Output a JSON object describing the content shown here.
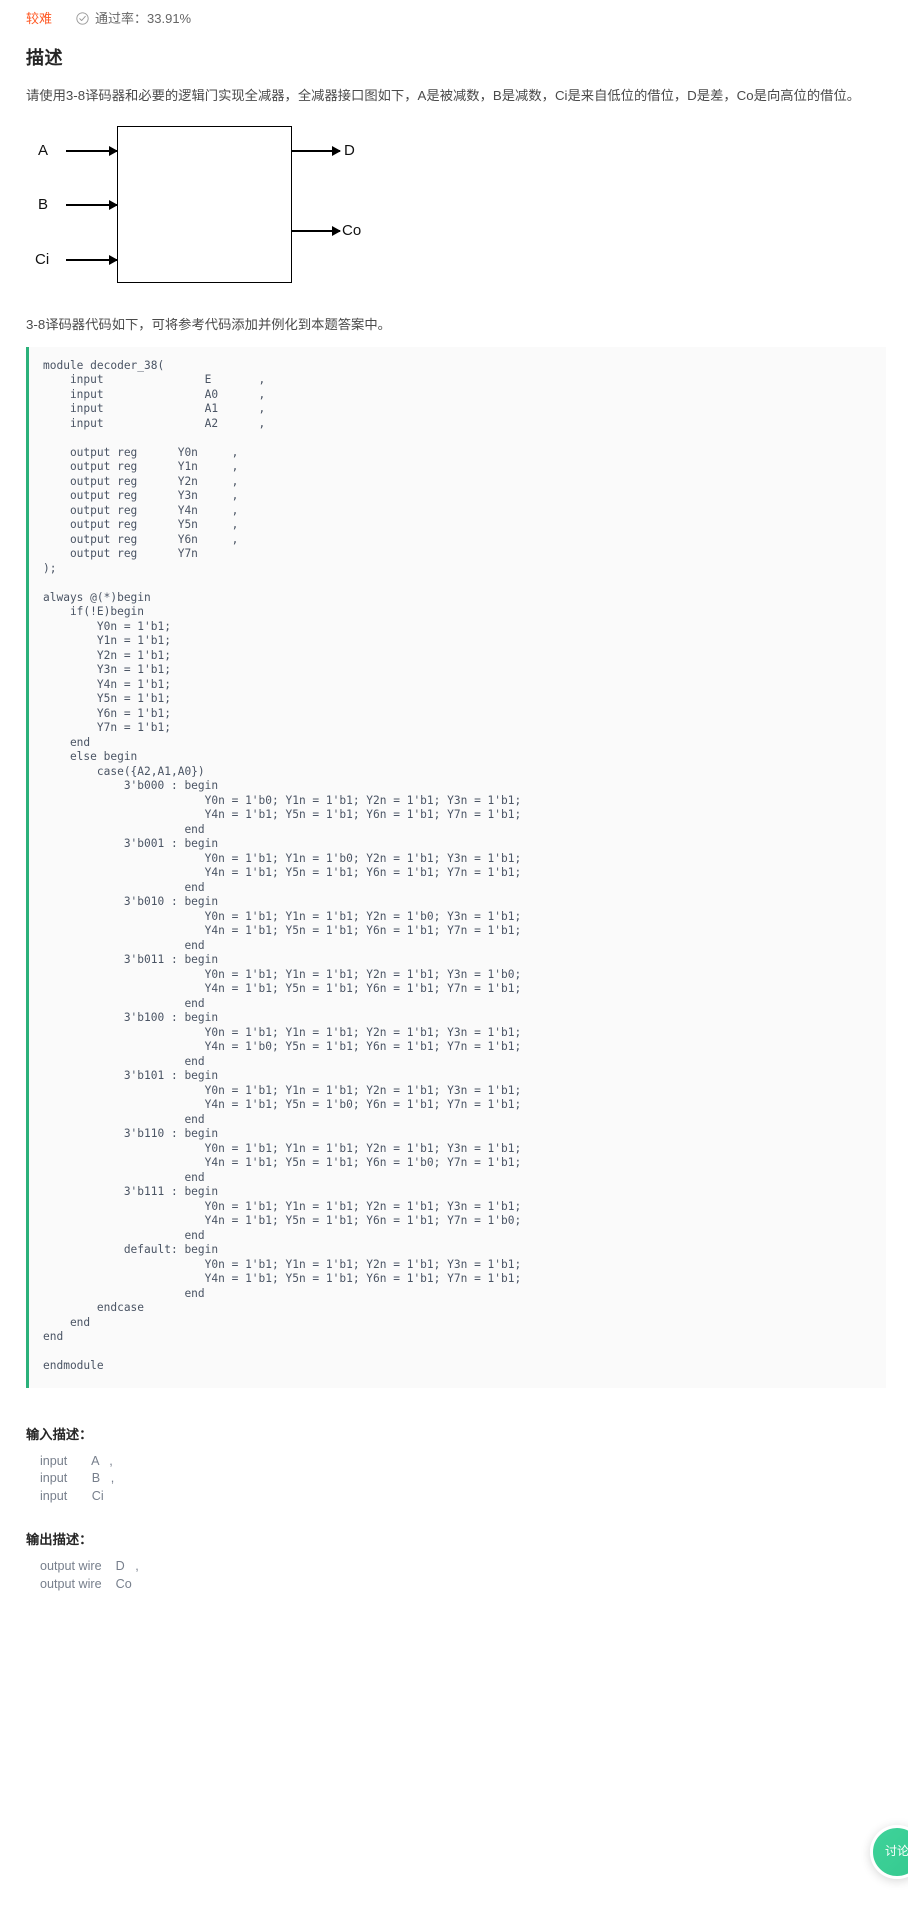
{
  "meta": {
    "difficulty": "较难",
    "pass_rate_label": "通过率：33.91%",
    "check_icon": "check-circle-icon"
  },
  "description": {
    "heading": "描述",
    "paragraph": "请使用3-8译码器和必要的逻辑门实现全减器，全减器接口图如下，A是被减数，B是减数，Ci是来自低位的借位，D是差，Co是向高位的借位。",
    "note": "3-8译码器代码如下，可将参考代码添加并例化到本题答案中。"
  },
  "diagram": {
    "inputs": [
      "A",
      "B",
      "Ci"
    ],
    "outputs": [
      "D",
      "Co"
    ],
    "label_a": "A",
    "label_b": "B",
    "label_ci": "Ci",
    "label_d": "D",
    "label_co": "Co"
  },
  "code": {
    "language": "verilog",
    "accent_color": "#2bb17a",
    "text": "module decoder_38(\n    input               E       ,\n    input               A0      ,\n    input               A1      ,\n    input               A2      ,\n\n    output reg      Y0n     ,\n    output reg      Y1n     ,\n    output reg      Y2n     ,\n    output reg      Y3n     ,\n    output reg      Y4n     ,\n    output reg      Y5n     ,\n    output reg      Y6n     ,\n    output reg      Y7n\n);\n\nalways @(*)begin\n    if(!E)begin\n        Y0n = 1'b1;\n        Y1n = 1'b1;\n        Y2n = 1'b1;\n        Y3n = 1'b1;\n        Y4n = 1'b1;\n        Y5n = 1'b1;\n        Y6n = 1'b1;\n        Y7n = 1'b1;\n    end\n    else begin\n        case({A2,A1,A0})\n            3'b000 : begin\n                        Y0n = 1'b0; Y1n = 1'b1; Y2n = 1'b1; Y3n = 1'b1;\n                        Y4n = 1'b1; Y5n = 1'b1; Y6n = 1'b1; Y7n = 1'b1;\n                     end\n            3'b001 : begin\n                        Y0n = 1'b1; Y1n = 1'b0; Y2n = 1'b1; Y3n = 1'b1;\n                        Y4n = 1'b1; Y5n = 1'b1; Y6n = 1'b1; Y7n = 1'b1;\n                     end\n            3'b010 : begin\n                        Y0n = 1'b1; Y1n = 1'b1; Y2n = 1'b0; Y3n = 1'b1;\n                        Y4n = 1'b1; Y5n = 1'b1; Y6n = 1'b1; Y7n = 1'b1;\n                     end\n            3'b011 : begin\n                        Y0n = 1'b1; Y1n = 1'b1; Y2n = 1'b1; Y3n = 1'b0;\n                        Y4n = 1'b1; Y5n = 1'b1; Y6n = 1'b1; Y7n = 1'b1;\n                     end\n            3'b100 : begin\n                        Y0n = 1'b1; Y1n = 1'b1; Y2n = 1'b1; Y3n = 1'b1;\n                        Y4n = 1'b0; Y5n = 1'b1; Y6n = 1'b1; Y7n = 1'b1;\n                     end\n            3'b101 : begin\n                        Y0n = 1'b1; Y1n = 1'b1; Y2n = 1'b1; Y3n = 1'b1;\n                        Y4n = 1'b1; Y5n = 1'b0; Y6n = 1'b1; Y7n = 1'b1;\n                     end\n            3'b110 : begin\n                        Y0n = 1'b1; Y1n = 1'b1; Y2n = 1'b1; Y3n = 1'b1;\n                        Y4n = 1'b1; Y5n = 1'b1; Y6n = 1'b0; Y7n = 1'b1;\n                     end\n            3'b111 : begin\n                        Y0n = 1'b1; Y1n = 1'b1; Y2n = 1'b1; Y3n = 1'b1;\n                        Y4n = 1'b1; Y5n = 1'b1; Y6n = 1'b1; Y7n = 1'b0;\n                     end\n            default: begin\n                        Y0n = 1'b1; Y1n = 1'b1; Y2n = 1'b1; Y3n = 1'b1;\n                        Y4n = 1'b1; Y5n = 1'b1; Y6n = 1'b1; Y7n = 1'b1;\n                     end\n        endcase\n    end\nend\n\nendmodule"
  },
  "input_desc": {
    "heading": "输入描述：",
    "text": "input       A   ,\ninput       B   ,\ninput       Ci"
  },
  "output_desc": {
    "heading": "输出描述：",
    "text": "output wire    D   ,\noutput wire    Co"
  },
  "fab": {
    "label": "讨论",
    "icon": "comment-bubble-icon",
    "color": "#35c98f"
  }
}
